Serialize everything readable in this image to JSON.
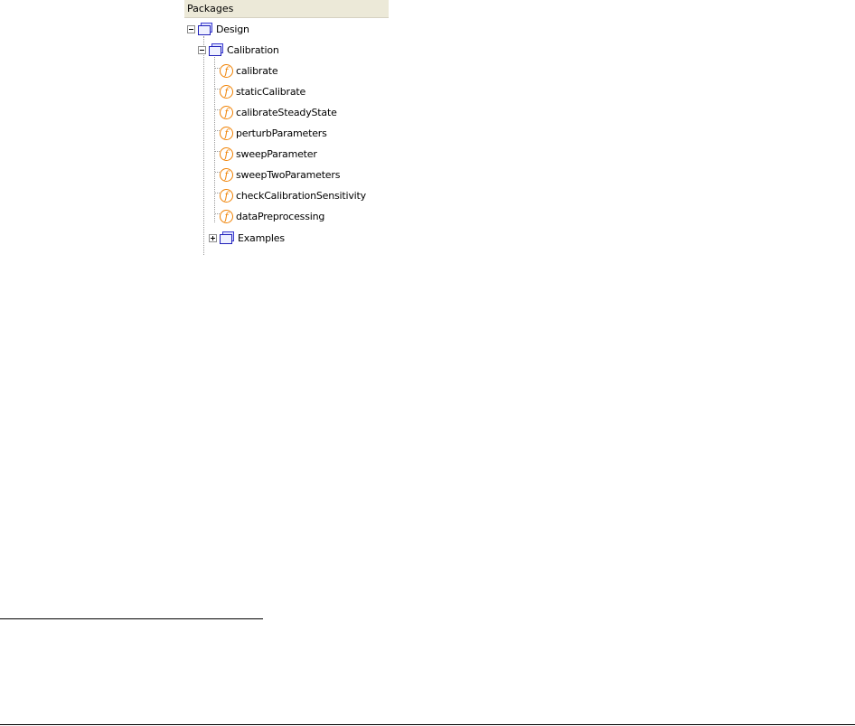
{
  "panel": {
    "header": "Packages"
  },
  "tree": {
    "root": {
      "label": "Design",
      "expanded": true,
      "icon": "package-icon"
    },
    "child": {
      "label": "Calibration",
      "expanded": true,
      "icon": "package-icon"
    },
    "functions": [
      {
        "label": "calibrate",
        "icon": "function-icon"
      },
      {
        "label": "staticCalibrate",
        "icon": "function-icon"
      },
      {
        "label": "calibrateSteadyState",
        "icon": "function-icon"
      },
      {
        "label": "perturbParameters",
        "icon": "function-icon"
      },
      {
        "label": "sweepParameter",
        "icon": "function-icon"
      },
      {
        "label": "sweepTwoParameters",
        "icon": "function-icon"
      },
      {
        "label": "checkCalibrationSensitivity",
        "icon": "function-icon"
      },
      {
        "label": "dataPreprocessing",
        "icon": "function-icon"
      }
    ],
    "examples": {
      "label": "Examples",
      "expanded": false,
      "icon": "package-icon"
    }
  },
  "colors": {
    "header_bg": "#ece9d8",
    "function_icon": "#f08000",
    "package_icon": "#2020b8"
  }
}
